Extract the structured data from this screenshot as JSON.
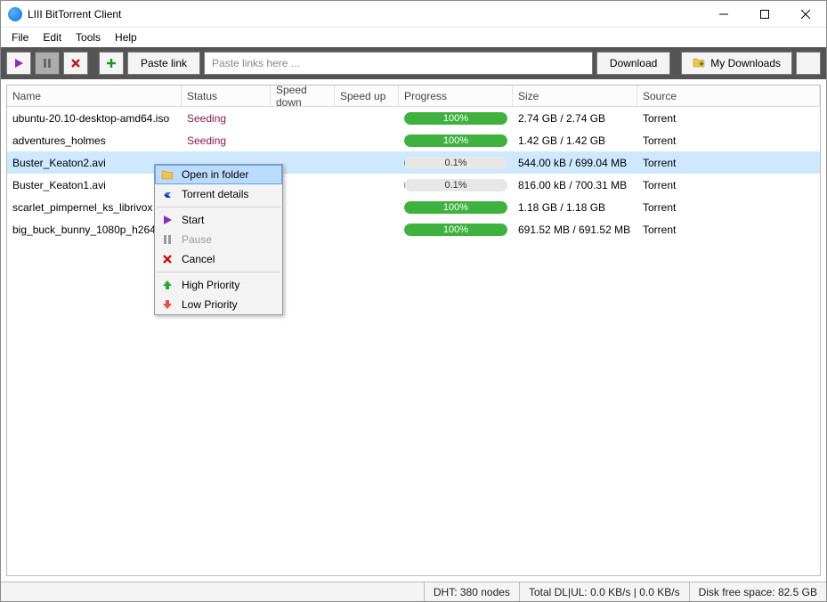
{
  "window": {
    "title": "LIII BitTorrent Client"
  },
  "menubar": [
    "File",
    "Edit",
    "Tools",
    "Help"
  ],
  "toolbar": {
    "paste_link_label": "Paste link",
    "link_placeholder": "Paste links here ...",
    "download_label": "Download",
    "my_downloads_label": "My Downloads"
  },
  "columns": {
    "name": "Name",
    "status": "Status",
    "speed_down": "Speed down",
    "speed_up": "Speed up",
    "progress": "Progress",
    "size": "Size",
    "source": "Source"
  },
  "torrents": [
    {
      "name": "ubuntu-20.10-desktop-amd64.iso",
      "status": "Seeding",
      "progress_pct": 100,
      "progress_label": "100%",
      "size": "2.74 GB / 2.74 GB",
      "source": "Torrent",
      "selected": false
    },
    {
      "name": "adventures_holmes",
      "status": "Seeding",
      "progress_pct": 100,
      "progress_label": "100%",
      "size": "1.42 GB / 1.42 GB",
      "source": "Torrent",
      "selected": false
    },
    {
      "name": "Buster_Keaton2.avi",
      "status": "",
      "progress_pct": 0.1,
      "progress_label": "0.1%",
      "size": "544.00 kB / 699.04 MB",
      "source": "Torrent",
      "selected": true
    },
    {
      "name": "Buster_Keaton1.avi",
      "status": "",
      "progress_pct": 0.1,
      "progress_label": "0.1%",
      "size": "816.00 kB / 700.31 MB",
      "source": "Torrent",
      "selected": false
    },
    {
      "name": "scarlet_pimpernel_ks_librivox",
      "status": "",
      "progress_pct": 100,
      "progress_label": "100%",
      "size": "1.18 GB / 1.18 GB",
      "source": "Torrent",
      "selected": false
    },
    {
      "name": "big_buck_bunny_1080p_h264",
      "status": "",
      "progress_pct": 100,
      "progress_label": "100%",
      "size": "691.52 MB / 691.52 MB",
      "source": "Torrent",
      "selected": false
    }
  ],
  "context_menu": [
    {
      "icon": "folder",
      "label": "Open in folder",
      "enabled": true,
      "hovered": true
    },
    {
      "icon": "details",
      "label": "Torrent details",
      "enabled": true
    },
    {
      "sep": true
    },
    {
      "icon": "start",
      "label": "Start",
      "enabled": true
    },
    {
      "icon": "pause",
      "label": "Pause",
      "enabled": false
    },
    {
      "icon": "cancel",
      "label": "Cancel",
      "enabled": true
    },
    {
      "sep": true
    },
    {
      "icon": "up",
      "label": "High Priority",
      "enabled": true
    },
    {
      "icon": "down",
      "label": "Low Priority",
      "enabled": true
    }
  ],
  "statusbar": {
    "dht": "DHT: 380 nodes",
    "speeds": "Total DL|UL: 0.0 KB/s | 0.0 KB/s",
    "disk": "Disk free space: 82.5 GB"
  }
}
